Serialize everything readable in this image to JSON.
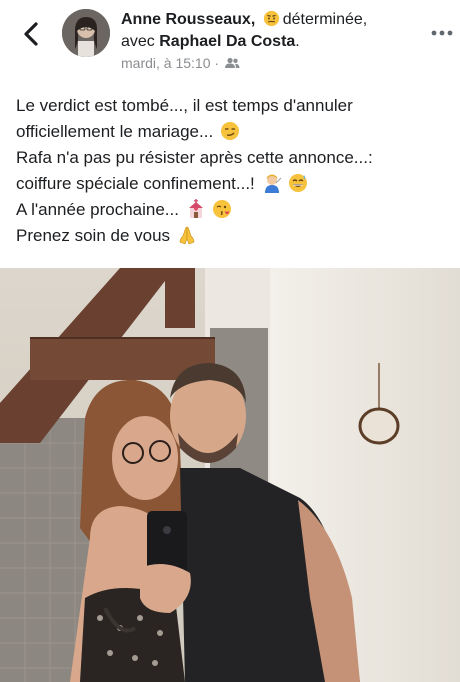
{
  "post": {
    "author": "Anne Rousseaux,",
    "feeling": "déterminée,",
    "with_prefix": "avec",
    "tagged": "Raphael Da Costa",
    "tagged_suffix": ".",
    "time": "mardi, à 15:10 ·",
    "audience_icon": "friends-icon",
    "lines": [
      "Le verdict est tombé..., il est temps d'annuler",
      "officiellement le mariage...",
      "Rafa n'a pas pu résister après cette annonce...:",
      "coiffure spéciale confinement...!",
      "A l'année prochaine...",
      "Prenez soin de vous"
    ],
    "line_emojis": [
      "",
      "smirking-face-emoji",
      "",
      "barber-and-grinning-sweat-emoji",
      "wedding-chapel-and-kiss-emoji",
      "folded-hands-emoji"
    ]
  },
  "icons": {
    "back": "chevron-left-icon",
    "more": "more-options-icon"
  },
  "photo": {
    "description_icon": "couple-mirror-selfie-photo"
  },
  "colors": {
    "text": "#1c1e21",
    "meta": "#8a8d91",
    "emoji_yellow": "#f7c23c"
  }
}
